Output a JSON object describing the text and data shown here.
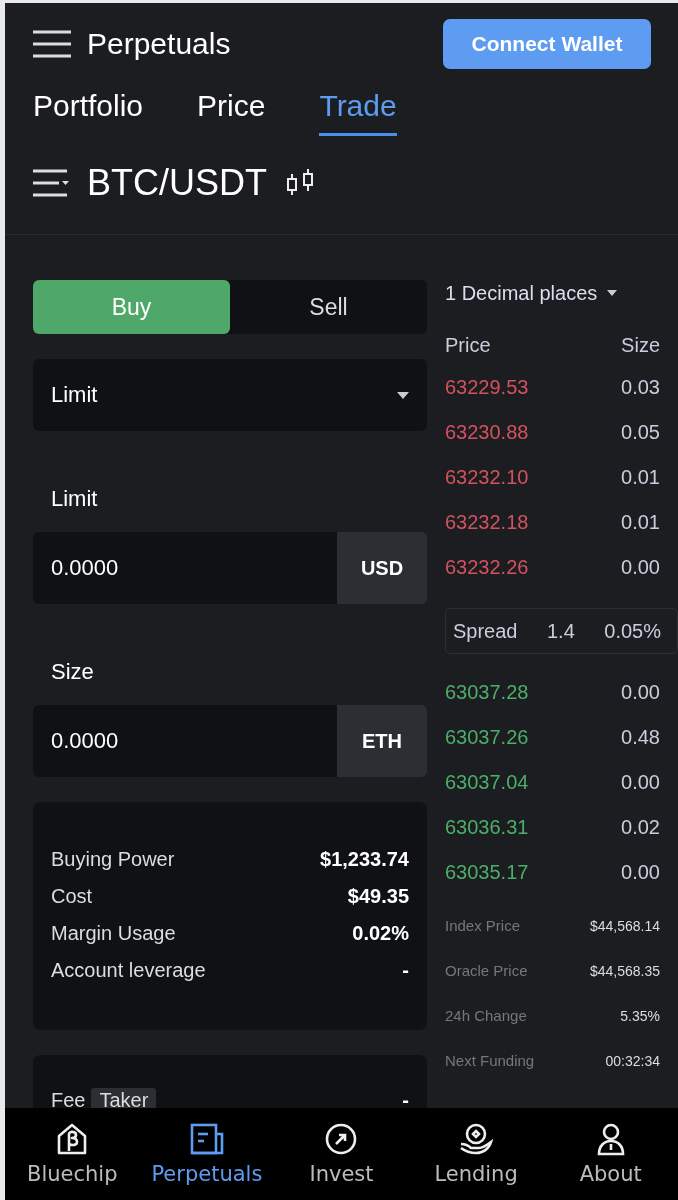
{
  "header": {
    "title": "Perpetuals",
    "connect_button": "Connect Wallet"
  },
  "tabs": [
    {
      "label": "Portfolio",
      "selected": false
    },
    {
      "label": "Price",
      "selected": false
    },
    {
      "label": "Trade",
      "selected": true
    }
  ],
  "market": {
    "pair": "BTC/USDT"
  },
  "order_form": {
    "sides": [
      {
        "label": "Buy",
        "selected": true
      },
      {
        "label": "Sell",
        "selected": false
      }
    ],
    "order_type": "Limit",
    "fields": [
      {
        "label": "Limit",
        "value": "0.0000",
        "unit": "USD"
      },
      {
        "label": "Size",
        "value": "0.0000",
        "unit": "ETH"
      }
    ],
    "summary": [
      {
        "label": "Buying Power",
        "value": "$1,233.74"
      },
      {
        "label": "Cost",
        "value": "$49.35"
      },
      {
        "label": "Margin Usage",
        "value": "0.02%"
      },
      {
        "label": "Account leverage",
        "value": "-"
      }
    ],
    "fee": {
      "label": "Fee",
      "tag": "Taker",
      "value": "-"
    }
  },
  "order_book": {
    "precision": "1 Decimal places",
    "columns": [
      "Price",
      "Size"
    ],
    "asks": [
      {
        "price": "63229.53",
        "size": "0.03"
      },
      {
        "price": "63230.88",
        "size": "0.05"
      },
      {
        "price": "63232.10",
        "size": "0.01"
      },
      {
        "price": "63232.18",
        "size": "0.01"
      },
      {
        "price": "63232.26",
        "size": "0.00"
      }
    ],
    "spread": {
      "label": "Spread",
      "value": "1.4",
      "percent": "0.05%"
    },
    "bids": [
      {
        "price": "63037.28",
        "size": "0.00"
      },
      {
        "price": "63037.26",
        "size": "0.48"
      },
      {
        "price": "63037.04",
        "size": "0.00"
      },
      {
        "price": "63036.31",
        "size": "0.02"
      },
      {
        "price": "63035.17",
        "size": "0.00"
      }
    ],
    "stats": [
      {
        "label": "Index Price",
        "value": "$44,568.14"
      },
      {
        "label": "Oracle Price",
        "value": "$44,568.35"
      },
      {
        "label": "24h Change",
        "value": "5.35%"
      },
      {
        "label": "Next Funding",
        "value": "00:32:34"
      }
    ]
  },
  "bottom_nav": [
    {
      "label": "Bluechip",
      "selected": false
    },
    {
      "label": "Perpetuals",
      "selected": true
    },
    {
      "label": "Invest",
      "selected": false
    },
    {
      "label": "Lending",
      "selected": false
    },
    {
      "label": "About",
      "selected": false
    }
  ]
}
